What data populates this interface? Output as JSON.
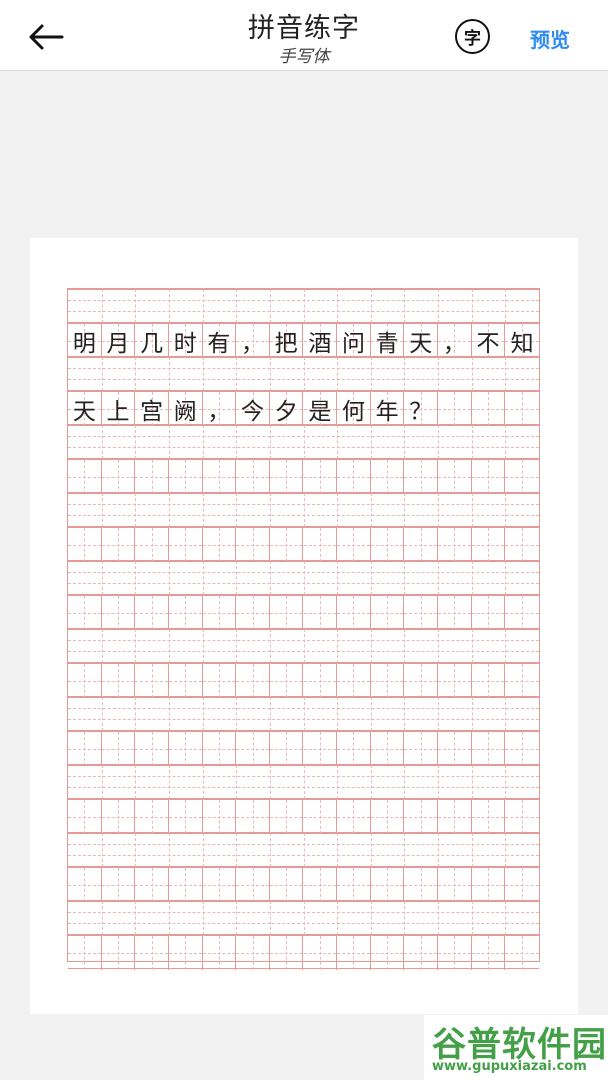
{
  "header": {
    "title": "拼音练字",
    "subtitle": "手写体",
    "char_button": "字",
    "preview_button": "预览",
    "back_icon": "arrow-left-icon"
  },
  "lines": [
    [
      "明",
      "月",
      "几",
      "时",
      "有",
      "，",
      "把",
      "酒",
      "问",
      "青",
      "天",
      "，",
      "不",
      "知"
    ],
    [
      "天",
      "上",
      "宫",
      "阙",
      "，",
      "今",
      "夕",
      "是",
      "何",
      "年",
      "？",
      "",
      "",
      ""
    ]
  ],
  "grid": {
    "columns": 14,
    "rows": 10,
    "line_color": "#e69a96",
    "dash_color": "#e8b9b7"
  },
  "watermark": {
    "name_cn": "谷普软件园",
    "url": "www.gupuxiazai.com",
    "color": "#43a047"
  }
}
